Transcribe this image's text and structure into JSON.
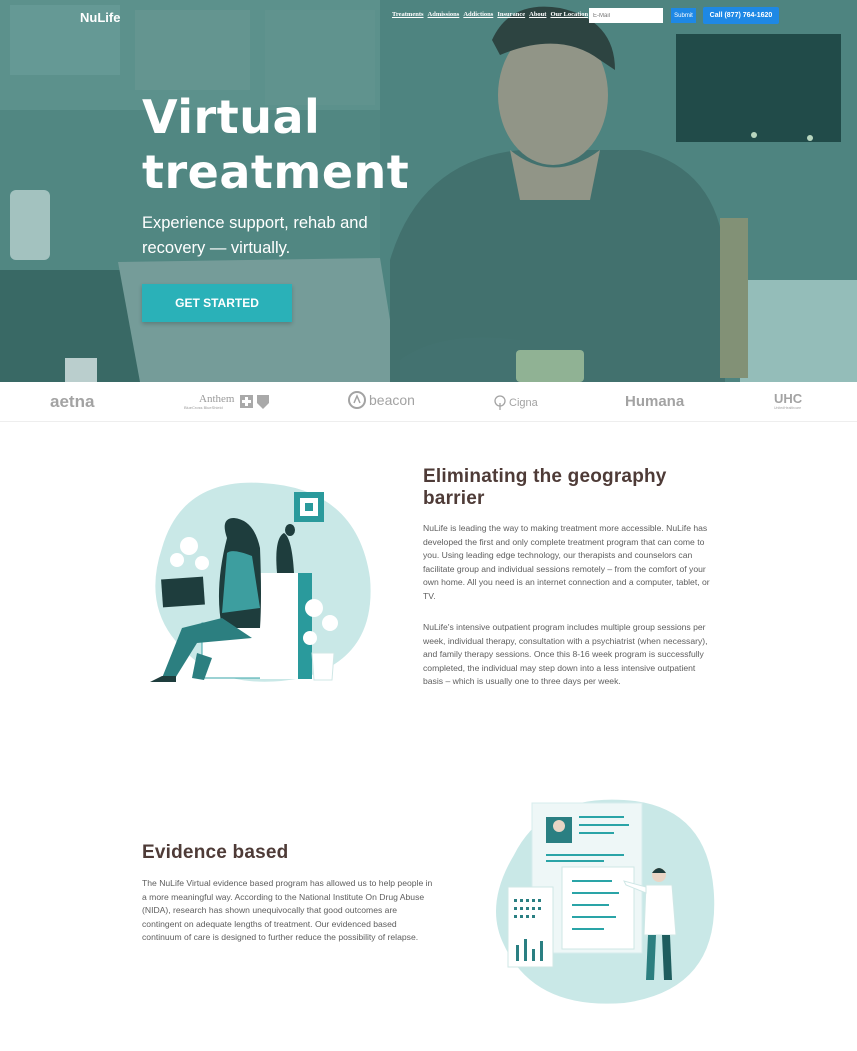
{
  "header": {
    "logo_text": "NuLife",
    "nav": [
      "Treatments",
      "Admissions",
      "Addictions",
      "Insurance",
      "About",
      "Our Location"
    ],
    "email_placeholder": "E-Mail",
    "submit_label": "Submit",
    "call_label": "Call (877) 764-1620"
  },
  "hero": {
    "title": "Virtual treatment",
    "subtitle": "Experience support, rehab and recovery — virtually.",
    "cta_label": "GET STARTED"
  },
  "insurers": {
    "aetna": "aetna",
    "anthem": "Anthem",
    "anthem_sub": "BlueCross BlueShield",
    "beacon": "beacon",
    "cigna": "Cigna",
    "humana": "Humana",
    "uhc": "UHC",
    "uhc_sub": "UnitedHealthcare"
  },
  "section1": {
    "title": "Eliminating the geography barrier",
    "para1": "NuLife is leading the way to making treatment more accessible. NuLife has developed the first and only complete treatment program that can come to you. Using leading edge technology, our therapists and counselors can facilitate group and individual sessions remotely – from the comfort of your own home. All you need is an internet connection and a computer, tablet, or TV.",
    "para2": "NuLife's intensive outpatient program includes multiple group sessions per week, individual therapy, consultation with a psychiatrist (when necessary), and family therapy sessions. Once this 8-16 week program is successfully completed, the individual may step down into a less intensive outpatient basis – which is usually one to three days per week."
  },
  "section2": {
    "title": "Evidence based",
    "para": "The NuLife Virtual evidence based program has allowed us to help people in a more meaningful way. According to the National Institute On Drug Abuse (NIDA), research has shown unequivocally that good outcomes are contingent on adequate lengths of treatment. Our evidenced based continuum of care is designed to further reduce the possibility of relapse."
  },
  "colors": {
    "accent": "#2ab1b8",
    "button_blue": "#1e88e5",
    "heading": "#4e3b37",
    "illustration_bg": "#c9e8e7"
  }
}
